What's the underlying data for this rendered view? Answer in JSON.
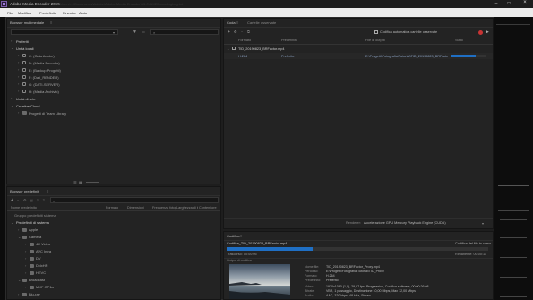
{
  "titlebar": {
    "title": "Adobe Media Encoder 2019",
    "background_path": "C:\\Users\\...\\Documents\\Adobe\\Adobe Media Encoder\\13.0\\AMEEncodingLog.txt"
  },
  "menubar": {
    "items": [
      "File",
      "Modifica",
      "Predefinito",
      "Finestra",
      "Aiuto"
    ]
  },
  "media_browser": {
    "title": "Browser multimediale",
    "search_placeholder": "",
    "favorites_label": "Preferiti",
    "local_drives_label": "Unità locali",
    "drives": [
      "C: (Gaia Adobe)",
      "D: (Media Encoder)",
      "E: (Backup Progetti)",
      "F: (Dati_RENDER)",
      "G: (DATI-SERVER)",
      "H: (Media Archivio)"
    ],
    "network_label": "Unità di rete",
    "cc_label": "Creative Cloud",
    "cc_item": "Progetti di Team Library"
  },
  "queue": {
    "title": "Coda",
    "tab2": "Cartelle osservate",
    "auto_encode_label": "Codifica automatica cartelle osservate",
    "columns": [
      "Formato",
      "Predefinito",
      "File di output",
      "Stato"
    ],
    "job": {
      "source": "TID_20190823_BRFactor.mp4",
      "format": "H.264",
      "preset": "Preferito",
      "output": "E:\\Progetti\\Fotografia\\Tutorial\\TID_20190823_BRFactor_Proxy.mp4",
      "progress": 0.7
    },
    "renderer_label": "Renderer:",
    "renderer_value": "Accelerazione GPU Mercury Playback Engine (CUDA)"
  },
  "preset_browser": {
    "title": "Browser predefiniti",
    "search_placeholder": "",
    "columns": [
      "Nome predefinito",
      "Formato",
      "Dimensioni",
      "Frequenza fotogrammi",
      "Larghezza di banda",
      "Contenitore"
    ],
    "group_label": "Gruppo predefiniti sistema",
    "system_presets": "Predefiniti di sistema",
    "items": [
      "Apple",
      "Camera",
      "4K Video",
      "AVC Intra",
      "DV",
      "DNxHR",
      "HEVC",
      "Sony",
      "XDCAM HD",
      "Blu-ray"
    ],
    "more_items": [
      "Broadcast",
      "MXF OP1a"
    ]
  },
  "encoding": {
    "title": "Codifica",
    "file_name": "Codifica_TID_20190823_BRFactor.mp4",
    "status": "Codifica del file in corso",
    "progress": 0.33,
    "elapsed_label": "Trascorso: 00:00:05",
    "remaining_label": "Rimanente: 00:00:11",
    "output_header": "Output di codifica",
    "details": [
      {
        "label": "Nome file:",
        "value": "TID_20190823_BRFactor_Proxy.mp4"
      },
      {
        "label": "Percorso:",
        "value": "E:\\Progetti\\Fotografia\\Tutorial\\TID_Proxy"
      },
      {
        "label": "Formato:",
        "value": "H.264"
      },
      {
        "label": "Predefinito:",
        "value": "Preferito"
      },
      {
        "label": "Video:",
        "value": "1920x1080 (1,0), 29,97 fps, Progressivo, Codifica software, 00:00:26:08"
      },
      {
        "label": "Bitrate:",
        "value": "VBR, 1 passaggio, Destinazione 10,00 Mbps, Max 12,00 Mbps"
      },
      {
        "label": "Audio:",
        "value": "AAC, 320 kbps, 48 kHz, Stereo"
      }
    ]
  },
  "colors": {
    "accent": "#2b6fd6",
    "progress": "#1f6fc4",
    "stop": "#c93434",
    "bg": "#1e1e1e"
  }
}
